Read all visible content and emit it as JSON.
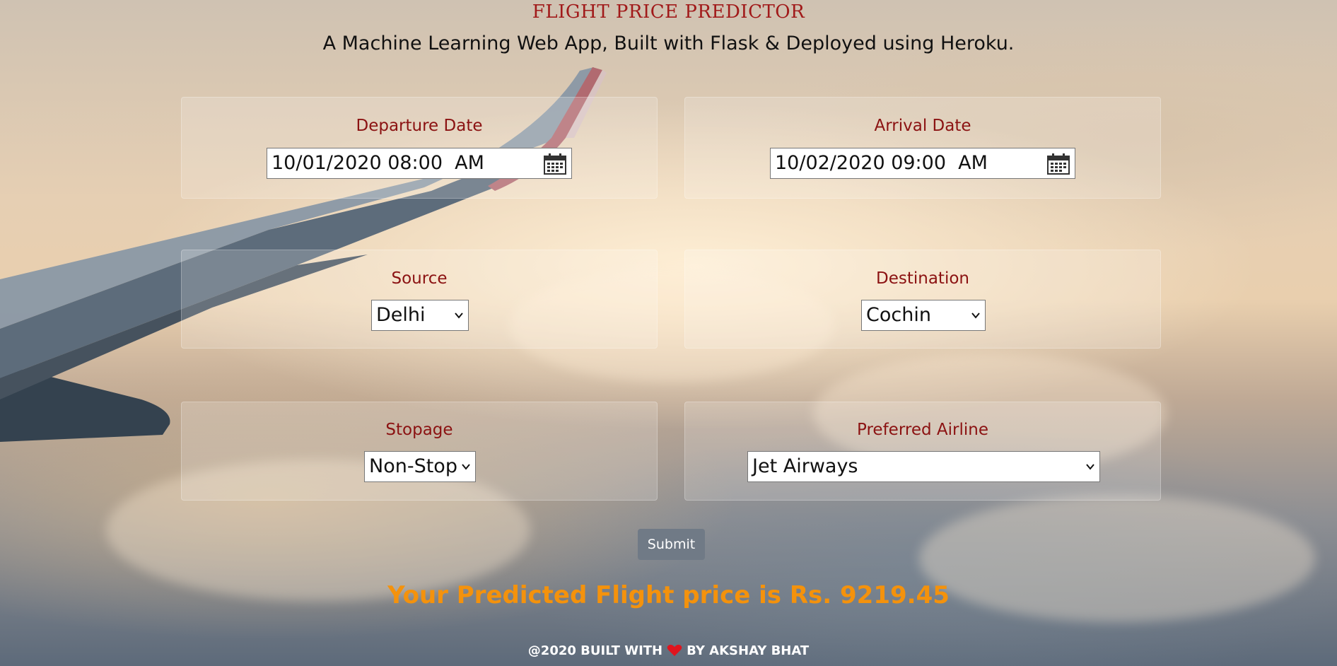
{
  "header": {
    "title": "FLIGHT PRICE PREDICTOR",
    "subtitle": "A Machine Learning Web App, Built with Flask & Deployed using Heroku."
  },
  "form": {
    "departure": {
      "label": "Departure Date",
      "value": "10/01/2020 08:00  AM",
      "icon": "calendar-icon"
    },
    "arrival": {
      "label": "Arrival Date",
      "value": "10/02/2020 09:00  AM",
      "icon": "calendar-icon"
    },
    "source": {
      "label": "Source",
      "selected": "Delhi"
    },
    "destination": {
      "label": "Destination",
      "selected": "Cochin"
    },
    "stopage": {
      "label": "Stopage",
      "selected": "Non-Stop"
    },
    "airline": {
      "label": "Preferred Airline",
      "selected": "Jet Airways"
    },
    "submit_label": "Submit"
  },
  "result": {
    "text": "Your Predicted Flight price is Rs. 9219.45"
  },
  "footer": {
    "prefix": "@2020 BUILT WITH",
    "suffix": "BY AKSHAY BHAT",
    "icon": "heart-icon"
  },
  "colors": {
    "label": "#8b1212",
    "title": "#a11a1a",
    "result": "#f4920c",
    "submit_bg": "#707a86"
  }
}
